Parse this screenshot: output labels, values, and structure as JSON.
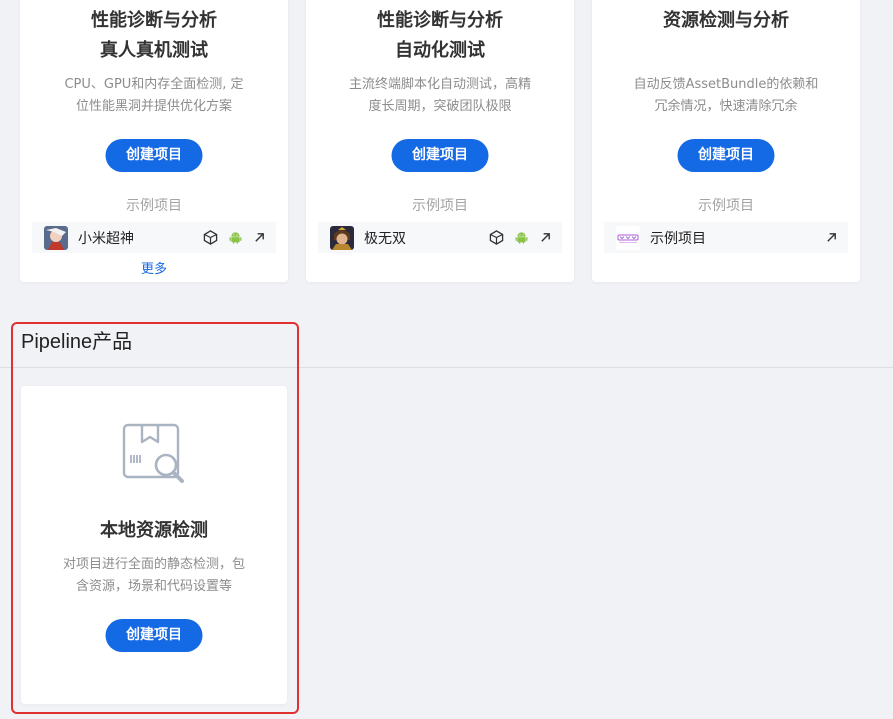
{
  "cards": [
    {
      "title_line1": "性能诊断与分析",
      "title_line2": "真人真机测试",
      "desc_line1": "CPU、GPU和内存全面检测, 定",
      "desc_line2": "位性能黑洞并提供优化方案",
      "create_label": "创建项目",
      "sample_label": "示例项目",
      "sample_name": "小米超神",
      "sample_icons": [
        "unity-icon",
        "android-icon",
        "external-link-icon"
      ],
      "more_label": "更多"
    },
    {
      "title_line1": "性能诊断与分析",
      "title_line2": "自动化测试",
      "desc_line1": "主流终端脚本化自动测试，高精",
      "desc_line2": "度长周期，突破团队极限",
      "create_label": "创建项目",
      "sample_label": "示例项目",
      "sample_name": "极无双",
      "sample_icons": [
        "unity-icon",
        "android-icon",
        "external-link-icon"
      ]
    },
    {
      "title_line1": "资源检测与分析",
      "desc_line1": "自动反馈AssetBundle的依赖和",
      "desc_line2": "冗余情况，快速清除冗余",
      "create_label": "创建项目",
      "sample_label": "示例项目",
      "sample_name": "示例项目",
      "sample_icons": [
        "external-link-icon"
      ]
    }
  ],
  "pipeline_section": {
    "title": "Pipeline产品",
    "card": {
      "icon": "package-search-icon",
      "title": "本地资源检测",
      "desc_line1": "对项目进行全面的静态检测，包",
      "desc_line2": "含资源，场景和代码设置等",
      "create_label": "创建项目"
    }
  },
  "colors": {
    "accent": "#1469e4",
    "highlight": "#e0302f",
    "background": "#f1f2f6"
  }
}
